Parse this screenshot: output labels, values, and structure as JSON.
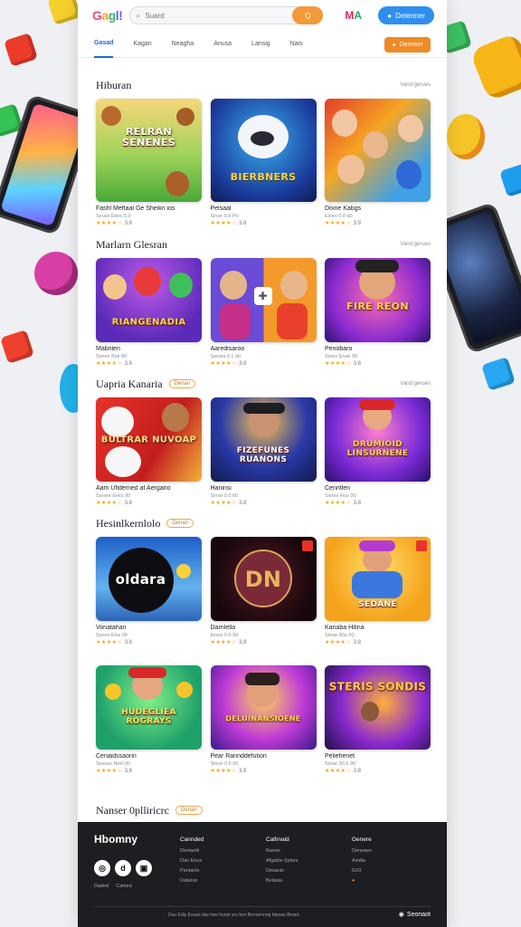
{
  "header": {
    "logo": [
      "G",
      "a",
      "g",
      "l",
      "!"
    ],
    "search_placeholder": "Suard",
    "search_button": "Q",
    "brand_mark_left": "M",
    "brand_mark_right": "A",
    "account_button": "Detenner"
  },
  "tabs": [
    "Gasad",
    "Kagan",
    "Neagha",
    "Anusa",
    "Lansig",
    "Nais"
  ],
  "tabs_button": "Dennser",
  "sections": [
    {
      "title": "Hiburan",
      "badge": "",
      "link": "Vand gerues",
      "cards": [
        {
          "title": "Fashl Meftaal Ge Sheikn ios",
          "meta": "Seuss Ekes 5.9",
          "thumb_text": "RELRAN SENENES",
          "rating": "3.8"
        },
        {
          "title": "Pelsaal",
          "meta": "Sinse 0.6 Po",
          "thumb_text": "BIERBNERS",
          "rating": "3.8"
        },
        {
          "title": "Doine Kabgs",
          "meta": "Eines 0.0 a0",
          "thumb_text": "",
          "rating": "3.9"
        }
      ]
    },
    {
      "title": "Marlarn Glesran",
      "badge": "",
      "link": "Vand gerues",
      "cards": [
        {
          "title": "Mabrilen",
          "meta": "Ssnee Bak 80",
          "thumb_text": "RIANGENADIA",
          "rating": "3.8"
        },
        {
          "title": "Aaredisaroo",
          "meta": "Sanwa 0.1 do",
          "thumb_text": "",
          "rating": "3.8"
        },
        {
          "title": "Penobaro",
          "meta": "Srses Enae 90",
          "thumb_text": "FIRE REON",
          "rating": "3.8"
        }
      ]
    },
    {
      "title": "Uapria Kanaria",
      "badge": "Denan",
      "link": "Vand gerues",
      "cards": [
        {
          "title": "Aam Ufiderned at Aergario",
          "meta": "Ssrses Eeks 90",
          "thumb_text": "BULTRAR NUVOAP",
          "rating": "3.8"
        },
        {
          "title": "Haninsi",
          "meta": "Sinse 0.0 60",
          "thumb_text": "FIZEFUNES RUANONS",
          "rating": "3.8"
        },
        {
          "title": "Cenntlen",
          "meta": "Ssnes Fiss 00",
          "thumb_text": "DRUMIOID LINSURNENE",
          "rating": "3.8"
        }
      ]
    },
    {
      "title": "Hesinlkernlolo",
      "badge": "Denan",
      "link": "",
      "cards": [
        {
          "title": "Vonatahan",
          "meta": "Ssnes Elss 99",
          "thumb_text": "oldara",
          "rating": "3.8"
        },
        {
          "title": "Darnlella",
          "meta": "Eines 0.6 90",
          "thumb_text": "DN",
          "rating": "3.8"
        },
        {
          "title": "Kanaba Hilina",
          "meta": "Sinae 80a 90",
          "thumb_text": "SEDANE",
          "rating": "3.8"
        }
      ]
    },
    {
      "title": "",
      "badge": "",
      "link": "",
      "cards": [
        {
          "title": "Cenaidssaonn",
          "meta": "Sesses Beel 00",
          "thumb_text": "HUDEGLIEA ROGRAYS",
          "rating": "3.8"
        },
        {
          "title": "Pear Rannddefution",
          "meta": "Sinee 0.6 60",
          "thumb_text": "DELUINANSIOENE",
          "rating": "3.8"
        },
        {
          "title": "Peliehenet",
          "meta": "Sinae 00.6 90",
          "thumb_text": "STERIS SONDIS",
          "rating": "3.8"
        }
      ]
    },
    {
      "title": "Nanser 0plliricrc",
      "badge": "Denan",
      "link": "",
      "cards": []
    }
  ],
  "footer": {
    "brand": "Hbomny",
    "columns": [
      {
        "head": "Cannded",
        "items": [
          "Denianiti",
          "Dan Enus",
          "Pantanis",
          "Datarus"
        ]
      },
      {
        "head": "Calhnaid",
        "items": [
          "Ranse",
          "Afgabie (Ipbes",
          "Desanis",
          "Belasia"
        ]
      },
      {
        "head": "Genere",
        "items": [
          "Deneaes",
          "Asidia",
          "G10",
          "●"
        ]
      }
    ],
    "social": [
      "◎",
      "d",
      "▣"
    ],
    "small_links": [
      "Daded",
      "Canied"
    ],
    "copyright": "Deu Ediy Esuas das hee hunal oru bes Benannnng Ideoas Bnant.",
    "language": "Seonaot"
  },
  "colors": {
    "accent": "#2f8ef0",
    "orange": "#f08a26",
    "star": "#f3a21c",
    "footer_bg": "#1d1e22"
  }
}
